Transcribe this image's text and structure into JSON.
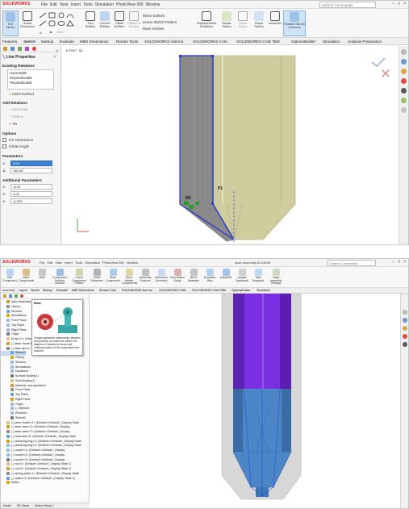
{
  "top": {
    "app_logo": "SOLIDWORKS",
    "menu": [
      "File",
      "Edit",
      "View",
      "Insert",
      "Tools",
      "Simulation",
      "PhotoView 360",
      "Window"
    ],
    "search_placeholder": "Search Commands",
    "ribbon": [
      {
        "label": "Exit Sketch",
        "active": true
      },
      {
        "label": "Smart Dimension"
      },
      {
        "label": "Trim Entities"
      },
      {
        "label": "Convert Entities"
      },
      {
        "label": "Offset Entities"
      },
      {
        "label": "Offset On Surface"
      },
      {
        "label": "Mirror Entities"
      },
      {
        "label": "Linear Sketch Pattern"
      },
      {
        "label": "Move Entities"
      },
      {
        "label": "Display/Delete Relations"
      },
      {
        "label": "Repair Sketch"
      },
      {
        "label": "Quick Snaps"
      },
      {
        "label": "Rapid Sketch"
      },
      {
        "label": "Instant2D"
      },
      {
        "label": "Shaded Sketch Contours",
        "active": true
      }
    ],
    "tabs": [
      "Features",
      "Sketch",
      "Markup",
      "Evaluate",
      "MBD Dimensions",
      "Render Tools",
      "SOLIDWORKS Add-Ins",
      "SOLIDWORKS CAM",
      "SOLIDWORKS CAM TBM",
      "OptionsBuilder",
      "Simulation",
      "Analysis Preparation"
    ],
    "breadcrumb": "laser- tip...",
    "pm": {
      "title": "Line Properties",
      "existing_relations": "Existing Relations",
      "relations": [
        "Horizontal9",
        "Perpendicular5",
        "Perpendicular8"
      ],
      "status": "Under Defined",
      "add_relations": "Add Relations",
      "add_items": [
        "Horizontal",
        "Vertical",
        "Fix"
      ],
      "options": "Options",
      "option_items": [
        "For construction",
        "Infinite length"
      ],
      "parameters": "Parameters",
      "param_values": [
        "5.00",
        "180.00°"
      ],
      "additional": "Additional Parameters",
      "additional_values": [
        "-6.30",
        "4.00",
        "-6.375"
      ]
    },
    "labels": {
      "p1": "P1",
      "m1": "M1"
    }
  },
  "bot": {
    "app_logo": "SOLIDWORKS",
    "menu": [
      "File",
      "Edit",
      "View",
      "Insert",
      "Tools",
      "Simulation",
      "PhotoView 360",
      "Window"
    ],
    "title": "laser Assembly.SLDASM",
    "search_placeholder": "Search Commands",
    "ribbon": [
      "Edit Component",
      "Insert Components",
      "Mate",
      "Component Preview Window",
      "Linear Component Pattern",
      "Smart Fasteners",
      "Move Component",
      "Show Hidden Components",
      "Assembly Features",
      "Reference Geometry",
      "New Motion Study",
      "Bill of Materials",
      "Exploded View",
      "Instant3D",
      "Update Speedpak",
      "Take Snapshot",
      "Large Assembly Settings"
    ],
    "tabs": [
      "Assembly",
      "Layout",
      "Sketch",
      "Markup",
      "Evaluate",
      "MBD Dimensions",
      "Render Tools",
      "SOLIDWORKS Add-Ins",
      "SOLIDWORKS CAM",
      "SOLIDWORKS CAM TBM",
      "OptionsBuilder",
      "Simulation"
    ],
    "tooltip_title": "Mate",
    "tooltip_text": "Creates geometric relationships between components. As mates are added, the degrees of freedom for linear and rotational motion of the components are reduced.",
    "tree": [
      "laser Assembly",
      "History",
      "Sensors",
      "Annotations",
      "Front Plane",
      "Top Plane",
      "Right Plane",
      "Origin",
      "(f) tip1<1> (Default<<Default>_Display State 1>)",
      "(-) laser-head<1> (Default<<Default>_Display State",
      "(-) laser-tip<1> (Default<<Default>_Display State",
      "Sketch4",
      "History",
      "Sensors",
      "Annotations",
      "Equations",
      "Surface Bodies(1)",
      "Solid Bodies(1)",
      "Material <not specified>",
      "Front Plane",
      "Top Plane",
      "Right Plane",
      "Origin",
      "(-) Sketch1",
      "Revolve1",
      "Sketch2",
      "(-) laser-holder<1> (Default<<Default>_Display State",
      "(-) laser-case<1> (Default<<Default>_Display",
      "(-) laser-case<2> (Default<<Default>_Display",
      "(-) heat-sink<1> (Default<<Default>_Display State",
      "(-) clamping-ring<1> (Default<<Default>_Display State",
      "(-) clamping-ring<2> (Default<<Default>_Display State",
      "(-) nozzle<1> (Default<<Default>_Display",
      "(-) nozzle<2> (Default<<Default>_Display",
      "(-) nozzle<3> (Default<<Default>_Display",
      "(-) nut<1> (Default<<Default>_Display State 1)",
      "(-) nut<2> (Default<<Default>_Display State 1)",
      "(-) spring-plate<1> (Default<<Default>_Display State",
      "(-) optics<1> (Default<<Default>_Display State 1)",
      "Mates"
    ],
    "bottom_tabs": [
      "Model",
      "3D Views",
      "Motion Study 1"
    ]
  },
  "colors": {
    "tan": "#cfcc9d",
    "gray_body": "#8a8a8a",
    "blue_sketch": "#2b3bd0",
    "purple": "#7a2fe2",
    "steel": "#4d86c6",
    "green": "#2a9b2a",
    "highlight": "#3d7fd0"
  }
}
